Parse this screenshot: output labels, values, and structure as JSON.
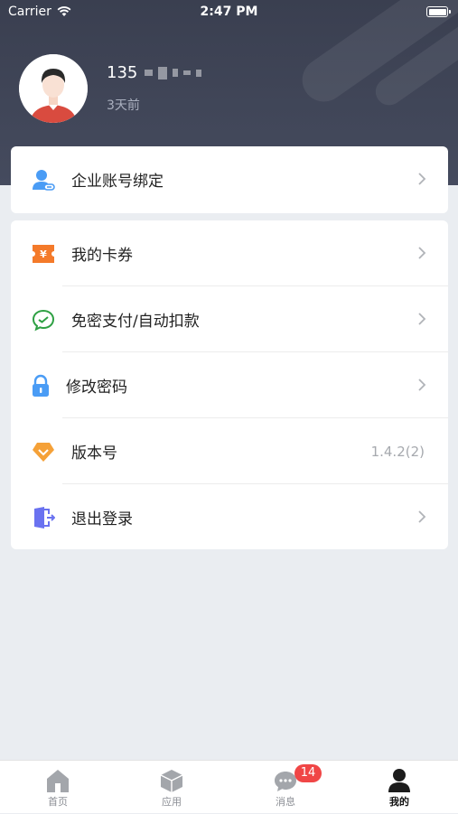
{
  "status_bar": {
    "carrier": "Carrier",
    "time": "2:47 PM"
  },
  "profile": {
    "username": "135",
    "last_login": "3天前"
  },
  "menu": {
    "enterprise_binding": "企业账号绑定",
    "my_coupons": "我的卡券",
    "password_free_pay": "免密支付/自动扣款",
    "change_password": "修改密码",
    "version_label": "版本号",
    "version_value": "1.4.2(2)",
    "logout": "退出登录"
  },
  "tabbar": {
    "home": "首页",
    "apps": "应用",
    "messages": "消息",
    "messages_badge": "14",
    "mine": "我的"
  },
  "colors": {
    "header_bg": "#3e4355",
    "badge": "#f04646",
    "coupon_icon": "#f47a2a",
    "wechat_icon": "#2ea043",
    "lock_icon": "#4a9cf5",
    "version_icon": "#f5a138",
    "logout_icon": "#6a72f0",
    "enterprise_icon": "#4a9cf5"
  }
}
